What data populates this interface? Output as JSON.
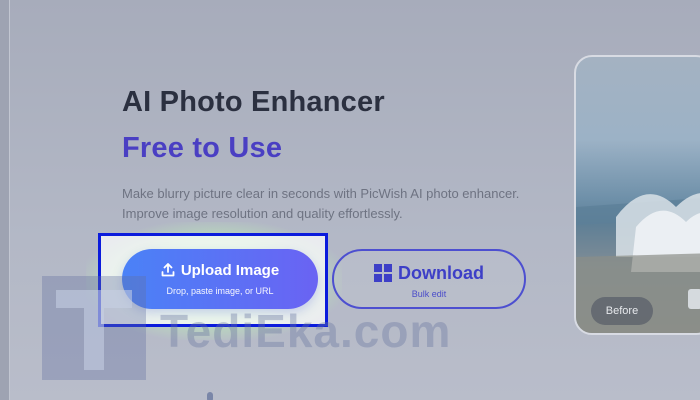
{
  "hero": {
    "title": "AI Photo Enhancer",
    "subtitle": "Free to Use",
    "description_line1": "Make blurry picture clear in seconds with PicWish AI photo enhancer.",
    "description_line2": "Improve image resolution and quality effortlessly."
  },
  "upload": {
    "label": "Upload Image",
    "sublabel": "Drop, paste image, or URL",
    "icon": "upload-icon"
  },
  "download": {
    "label": "Download",
    "sublabel": "Bulk edit",
    "icon": "windows-icon"
  },
  "preview": {
    "badge": "Before"
  },
  "watermark": {
    "letter": "T",
    "text": "TediEka.com"
  },
  "colors": {
    "title": "#2b3040",
    "subtitle": "#4a3fc3",
    "upload_gradient_start": "#4a82f7",
    "upload_gradient_end": "#6a63f3",
    "download_border": "#4d4fd0",
    "highlight_box": "#0b1bdc",
    "glow": "#a8ff9e"
  }
}
